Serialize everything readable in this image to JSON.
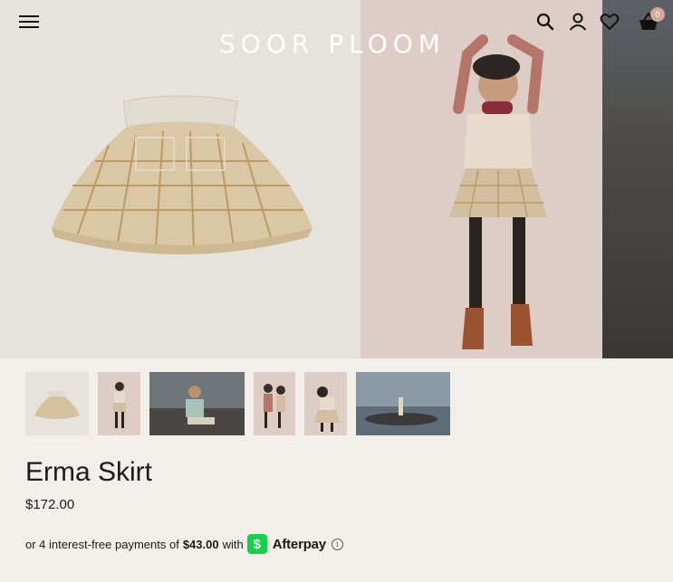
{
  "brand": {
    "logo_text": "SOOR PLOOM"
  },
  "header": {
    "cart_count": "0",
    "icons": [
      "menu-icon",
      "search-icon",
      "account-icon",
      "heart-icon",
      "basket-icon"
    ]
  },
  "product": {
    "title": "Erma Skirt",
    "price": "$172.00"
  },
  "afterpay": {
    "prefix": "or 4 interest-free payments of",
    "amount": "$43.00",
    "connector": "with",
    "badge_glyph": "$",
    "brand": "Afterpay",
    "info_glyph": "i"
  },
  "colors": {
    "background": "#f2efea",
    "text": "#1a1a1a",
    "afterpay_green": "#16d14a",
    "cart_badge": "#d6a79c"
  }
}
